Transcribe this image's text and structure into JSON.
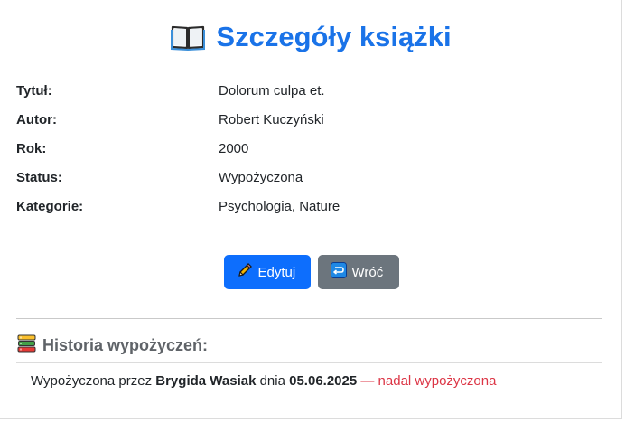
{
  "header": {
    "icon": "open-book-icon",
    "title": "Szczegóły książki"
  },
  "details": [
    {
      "label": "Tytuł:",
      "value": "Dolorum culpa et."
    },
    {
      "label": "Autor:",
      "value": "Robert Kuczyński"
    },
    {
      "label": "Rok:",
      "value": "2000"
    },
    {
      "label": "Status:",
      "value": "Wypożyczona"
    },
    {
      "label": "Kategorie:",
      "value": "Psychologia, Nature"
    }
  ],
  "actions": {
    "edit_label": "Edytuj",
    "edit_icon": "pencil-icon",
    "back_label": "Wróć",
    "back_icon": "return-arrow-icon"
  },
  "history": {
    "icon": "books-stack-icon",
    "title": "Historia wypożyczeń:",
    "entries": [
      {
        "prefix": "Wypożyczona przez",
        "borrower": "Brygida Wasiak",
        "date_prefix": "dnia",
        "date": "05.06.2025",
        "status": "— nadal wypożyczona"
      }
    ]
  },
  "colors": {
    "title": "#1a73e8",
    "primary_button": "#0d6efd",
    "secondary_button": "#6c757d",
    "status_danger": "#dc3545"
  }
}
